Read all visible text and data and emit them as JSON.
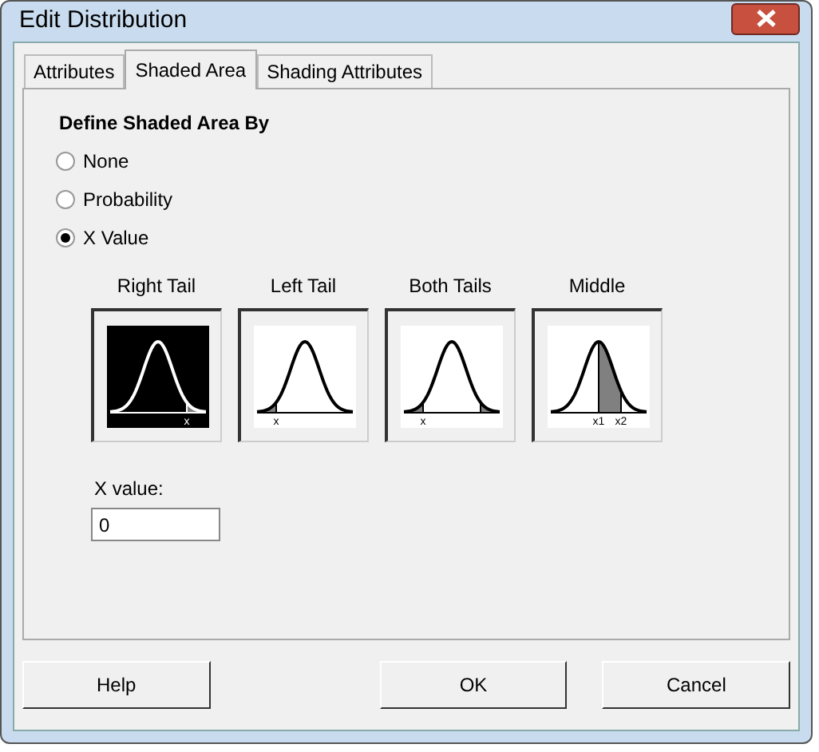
{
  "window": {
    "title": "Edit Distribution"
  },
  "tabs": [
    {
      "label": "Attributes",
      "selected": false
    },
    {
      "label": "Shaded Area",
      "selected": true
    },
    {
      "label": "Shading Attributes",
      "selected": false
    }
  ],
  "group_label": "Define Shaded Area By",
  "options": [
    {
      "label": "None",
      "selected": false
    },
    {
      "label": "Probability",
      "selected": false
    },
    {
      "label": "X Value",
      "selected": true
    }
  ],
  "shading_types": [
    {
      "label": "Right Tail",
      "kind": "right_tail",
      "selected": true,
      "marks": [
        "x"
      ]
    },
    {
      "label": "Left Tail",
      "kind": "left_tail",
      "selected": false,
      "marks": [
        "x"
      ]
    },
    {
      "label": "Both Tails",
      "kind": "both_tails",
      "selected": false,
      "marks": [
        "x"
      ]
    },
    {
      "label": "Middle",
      "kind": "middle",
      "selected": false,
      "marks": [
        "x1",
        "x2"
      ]
    }
  ],
  "x_value": {
    "label": "X value:",
    "value": "0"
  },
  "buttons": [
    {
      "label": "Help",
      "kind": "help"
    },
    {
      "label": "OK",
      "kind": "ok"
    },
    {
      "label": "Cancel",
      "kind": "cancel"
    }
  ]
}
